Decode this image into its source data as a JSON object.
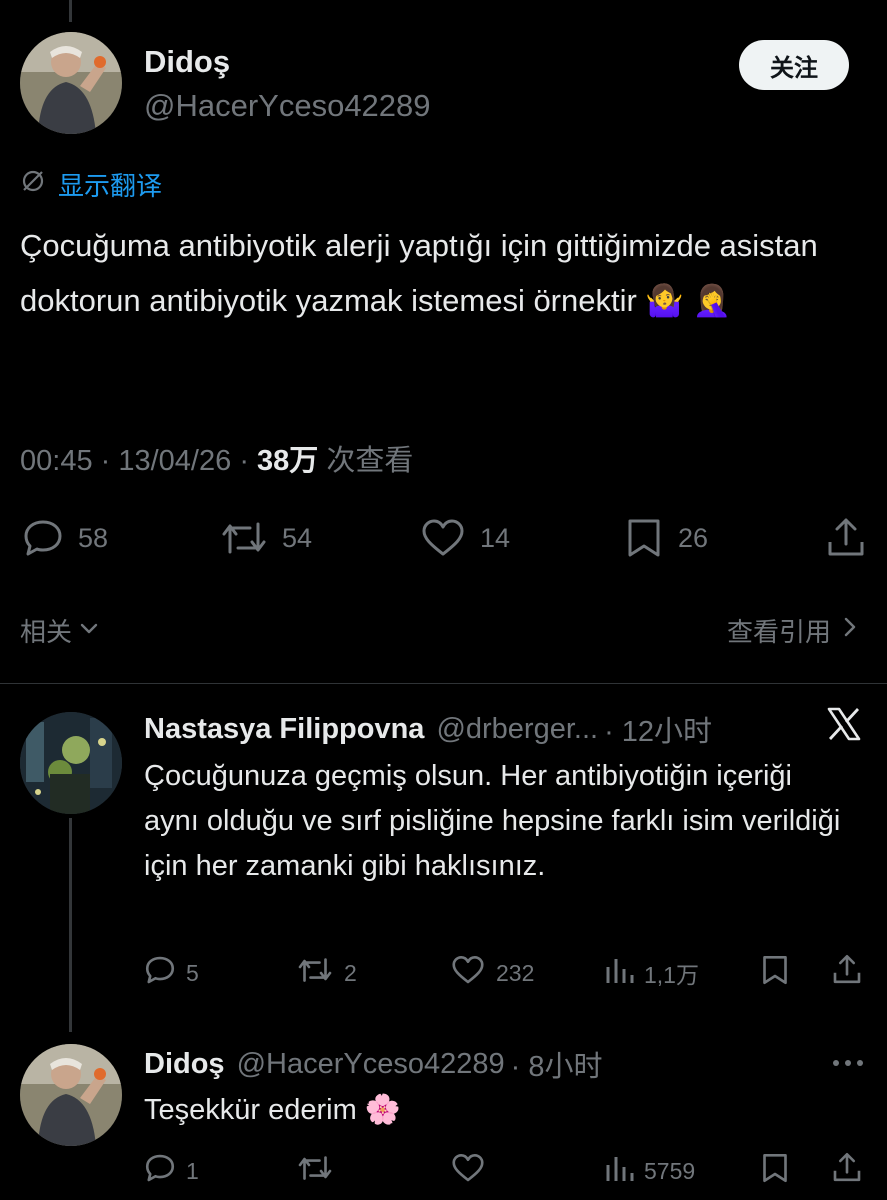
{
  "main_tweet": {
    "author_name": "Didoş",
    "author_handle": "@HacerYceso42289",
    "follow_label": "关注",
    "translate_label": "显示翻译",
    "text": "Çocuğuma antibiyotik alerji yaptığı için gittiğimizde asistan doktorun antibiyotik yazmak istemesi  örnektir 🤷‍♀️ 🤦‍♀️",
    "time": "00:45",
    "date": "13/04/26",
    "views_count": "38万",
    "views_label": "次查看",
    "replies": "58",
    "retweets": "54",
    "likes": "14",
    "bookmarks": "26"
  },
  "filter_bar": {
    "related_label": "相关",
    "quotes_label": "查看引用"
  },
  "reply1": {
    "author_name": "Nastasya Filippovna",
    "author_handle": "@drberger...",
    "time": "· 12小时",
    "text": "Çocuğunuza geçmiş olsun. Her antibiyotiğin içeriği aynı olduğu ve sırf pisliğine hepsine farklı isim verildiği için her zamanki gibi haklısınız.",
    "replies": "5",
    "retweets": "2",
    "likes": "232",
    "views": "1,1万"
  },
  "reply2": {
    "author_name": "Didoş",
    "author_handle": "@HacerYceso42289",
    "time": "· 8小时",
    "text": "Teşekkür ederim 🌸",
    "replies": "1",
    "views": "5759"
  },
  "colors": {
    "background": "#000000",
    "text_primary": "#e7e9ea",
    "text_secondary": "#71767b",
    "accent": "#1d9bf0",
    "divider": "#2f3336"
  },
  "icons": [
    "reply-icon",
    "retweet-icon",
    "like-icon",
    "bookmark-icon",
    "share-icon",
    "views-icon",
    "x-logo-icon",
    "more-icon",
    "translate-icon",
    "chevron-down-icon",
    "chevron-right-icon"
  ]
}
